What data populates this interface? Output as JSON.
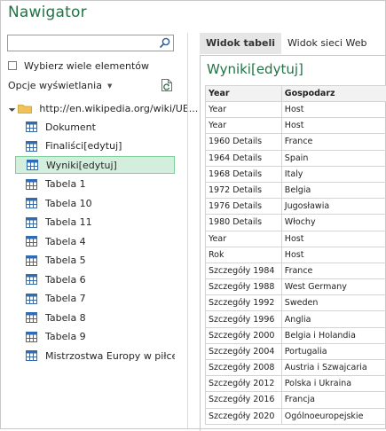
{
  "window": {
    "title": "Nawigator"
  },
  "search": {
    "value": "",
    "placeholder": ""
  },
  "multi_select": {
    "label": "Wybierz wiele elementów",
    "checked": false
  },
  "display_options": {
    "label": "Opcje wyświetlania"
  },
  "tree": {
    "root_label": "http://en.wikipedia.org/wiki/UE...",
    "items": [
      {
        "label": "Dokument",
        "selected": false
      },
      {
        "label": "Finaliści[edytuj]",
        "selected": false
      },
      {
        "label": "Wyniki[edytuj]",
        "selected": true
      },
      {
        "label": "Tabela 1",
        "selected": false
      },
      {
        "label": "Tabela 10",
        "selected": false
      },
      {
        "label": "Tabela 11",
        "selected": false
      },
      {
        "label": "Tabela 4",
        "selected": false
      },
      {
        "label": "Tabela 5",
        "selected": false
      },
      {
        "label": "Tabela 6",
        "selected": false
      },
      {
        "label": "Tabela 7",
        "selected": false
      },
      {
        "label": "Tabela 8",
        "selected": false
      },
      {
        "label": "Tabela 9",
        "selected": false
      },
      {
        "label": "Mistrzostwa Europy w piłce n...",
        "selected": false
      }
    ]
  },
  "tabs": [
    {
      "label": "Widok tabeli",
      "active": true
    },
    {
      "label": "Widok sieci Web",
      "active": false
    }
  ],
  "preview": {
    "title": "Wyniki[edytuj]",
    "columns": [
      "Year",
      "Gospodarz"
    ],
    "rows": [
      [
        "Year",
        "Host"
      ],
      [
        "Year",
        "Host"
      ],
      [
        "1960 Details",
        "France"
      ],
      [
        "1964 Details",
        "Spain"
      ],
      [
        "1968 Details",
        "Italy"
      ],
      [
        "1972 Details",
        "Belgia"
      ],
      [
        "1976 Details",
        "Jugosławia"
      ],
      [
        "1980 Details",
        "Włochy"
      ],
      [
        "Year",
        "Host"
      ],
      [
        "Rok",
        "Host"
      ],
      [
        "Szczegóły 1984",
        "France"
      ],
      [
        "Szczegóły 1988",
        "West Germany"
      ],
      [
        "Szczegóły 1992",
        "Sweden"
      ],
      [
        "Szczegóły 1996",
        "Anglia"
      ],
      [
        "Szczegóły 2000",
        "Belgia i Holandia"
      ],
      [
        "Szczegóły 2004",
        "Portugalia"
      ],
      [
        "Szczegóły 2008",
        "Austria i Szwajcaria"
      ],
      [
        "Szczegóły 2012",
        "Polska i Ukraina"
      ],
      [
        "Szczegóły 2016",
        "Francja"
      ],
      [
        "Szczegóły 2020",
        "Ogólnoeuropejskie"
      ]
    ]
  },
  "colors": {
    "accent": "#217346",
    "selection_bg": "#d3eedc",
    "table_icon": "#2e6db5"
  }
}
